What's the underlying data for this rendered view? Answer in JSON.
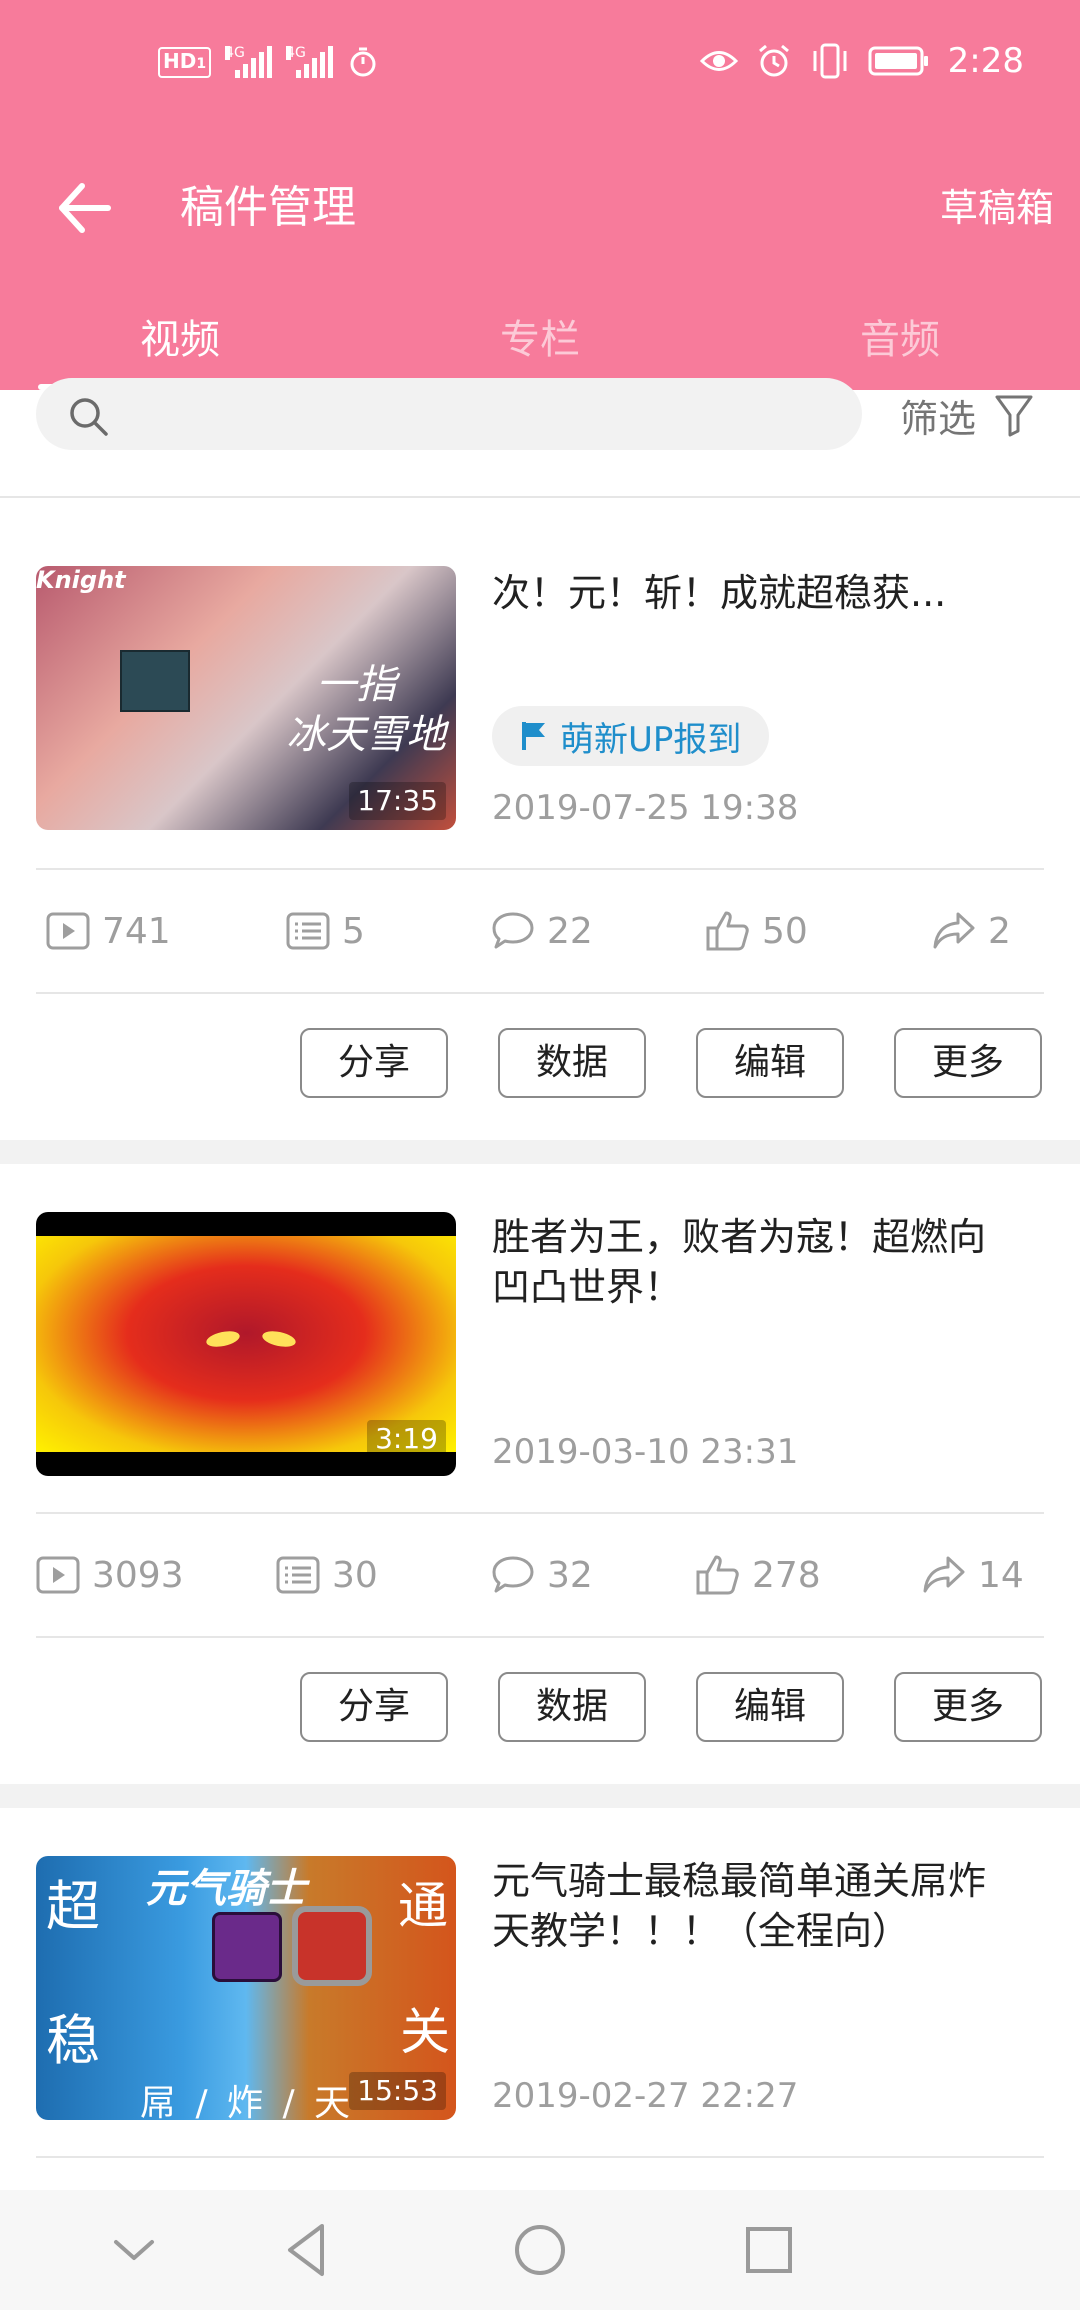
{
  "status_bar": {
    "hd_label": "HD",
    "hd_sub": "1",
    "sim1_label": "4G",
    "sim2_label": "4G",
    "time": "2:28"
  },
  "header": {
    "title": "稿件管理",
    "draft_label": "草稿箱"
  },
  "tabs": [
    {
      "label": "视频",
      "active": true
    },
    {
      "label": "专栏",
      "active": false
    },
    {
      "label": "音频",
      "active": false
    }
  ],
  "search": {
    "placeholder": "",
    "filter_label": "筛选"
  },
  "videos": [
    {
      "title": "次！元！斩！成就超稳获...",
      "badge": "萌新UP报到",
      "date": "2019-07-25 19:38",
      "duration": "17:35",
      "thumb_text_1": "一指",
      "thumb_text_2": "冰天雪地",
      "thumb_text_top": "Knight",
      "stats": {
        "plays": "741",
        "danmaku": "5",
        "comments": "22",
        "likes": "50",
        "shares": "2"
      }
    },
    {
      "title": "胜者为王，败者为寇！超燃向凹凸世界！",
      "date": "2019-03-10 23:31",
      "duration": "3:19",
      "stats": {
        "plays": "3093",
        "danmaku": "30",
        "comments": "32",
        "likes": "278",
        "shares": "14"
      }
    },
    {
      "title": "元气骑士最稳最简单通关屌炸天教学！！！（全程向）",
      "date": "2019-02-27 22:27",
      "duration": "15:53",
      "thumb_text_tl": "超",
      "thumb_text_bl": "稳",
      "thumb_text_tr": "通",
      "thumb_text_br": "关",
      "thumb_text_logo": "元气骑士",
      "thumb_text_bottom": "屌 / 炸 / 天"
    }
  ],
  "actions": {
    "share": "分享",
    "data": "数据",
    "edit": "编辑",
    "more": "更多"
  },
  "colors": {
    "brand_pink": "#f77b9b",
    "badge_blue": "#1f8ecb",
    "text_gray": "#9e9e9e"
  }
}
